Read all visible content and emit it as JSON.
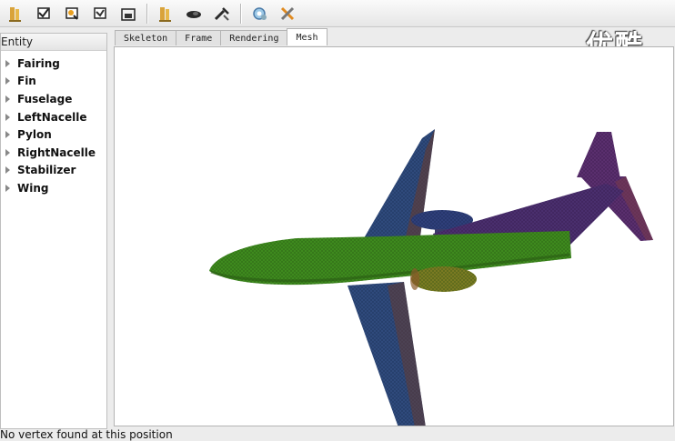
{
  "toolbar": {
    "icons": [
      "open-folder-icon",
      "print-icon",
      "print-preview-icon",
      "print-setup-icon",
      "save-icon",
      "open-model-icon",
      "view-icon",
      "tool-icon",
      "settings-icon",
      "close-tools-icon"
    ]
  },
  "watermark": {
    "text": "优酷"
  },
  "entity_panel": {
    "header": "Entity",
    "items": [
      {
        "label": "Fairing"
      },
      {
        "label": "Fin"
      },
      {
        "label": "Fuselage"
      },
      {
        "label": "LeftNacelle"
      },
      {
        "label": "Pylon"
      },
      {
        "label": "RightNacelle"
      },
      {
        "label": "Stabilizer"
      },
      {
        "label": "Wing"
      }
    ]
  },
  "tabs": [
    {
      "label": "Skeleton",
      "active": false
    },
    {
      "label": "Frame",
      "active": false
    },
    {
      "label": "Rendering",
      "active": false
    },
    {
      "label": "Mesh",
      "active": true
    }
  ],
  "status": {
    "text": "No vertex found at this position"
  },
  "colors": {
    "fuselage": "#3e8a1e",
    "wing": "#2f4a7c",
    "fin": "#5a2f6e",
    "nacelle": "#7a7a22"
  }
}
